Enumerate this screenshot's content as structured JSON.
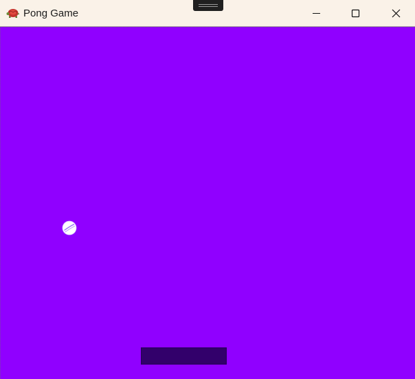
{
  "window": {
    "title": "Pong Game",
    "app_icon": "red-turtle-icon",
    "controls": [
      "minimize-icon",
      "maximize-icon",
      "close-icon"
    ]
  },
  "game": {
    "background_color": "#9000ff",
    "ball_icon": "white-ball-icon",
    "ball_color": "#ffffff",
    "paddle_color": "#32006b"
  }
}
